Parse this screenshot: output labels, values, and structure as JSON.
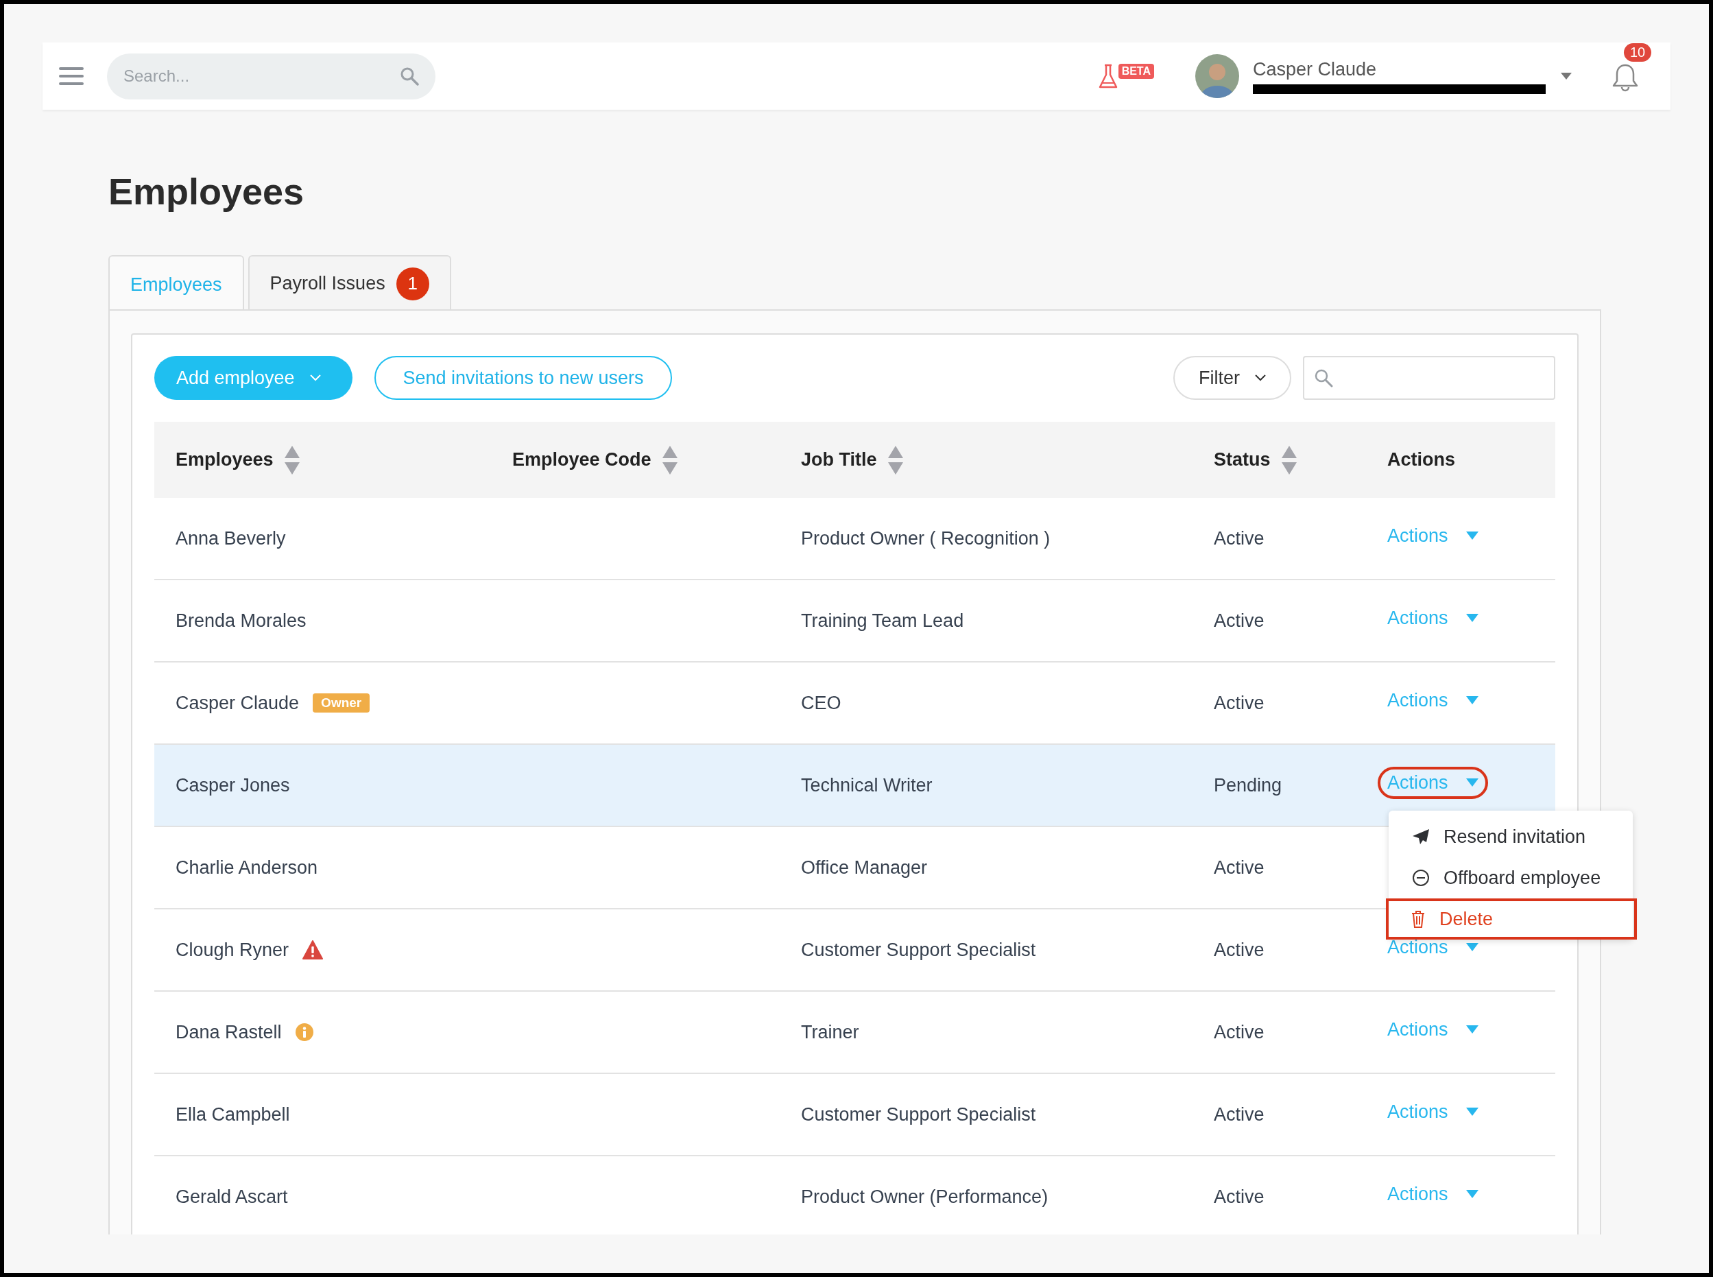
{
  "header": {
    "search": {
      "placeholder": "Search..."
    },
    "beta_label": "BETA",
    "user": {
      "name": "Casper Claude"
    },
    "notifications": {
      "count": "10"
    }
  },
  "page_title": "Employees",
  "tabs": [
    {
      "label": "Employees",
      "selected": true
    },
    {
      "label": "Payroll Issues",
      "selected": false,
      "badge": "1"
    }
  ],
  "toolbar": {
    "add_button": "Add employee",
    "invite_button": "Send invitations to new users",
    "filter_button": "Filter"
  },
  "table": {
    "columns": [
      {
        "label": "Employees",
        "sortable": true
      },
      {
        "label": "Employee Code",
        "sortable": true
      },
      {
        "label": "Job Title",
        "sortable": true
      },
      {
        "label": "Status",
        "sortable": true
      },
      {
        "label": "Actions",
        "sortable": false
      }
    ],
    "rows": [
      {
        "name": "Anna Beverly",
        "job_title": "Product Owner ( Recognition )",
        "status": "Active",
        "actions": {
          "label": "Actions",
          "highlighted": false
        },
        "selected": false
      },
      {
        "name": "Brenda Morales",
        "job_title": "Training Team Lead",
        "status": "Active",
        "actions": {
          "label": "Actions",
          "highlighted": false
        },
        "selected": false
      },
      {
        "name": "Casper Claude",
        "marker": {
          "kind": "badge",
          "label": "Owner"
        },
        "job_title": "CEO",
        "status": "Active",
        "actions": {
          "label": "Actions",
          "highlighted": false
        },
        "selected": false
      },
      {
        "name": "Casper Jones",
        "job_title": "Technical Writer",
        "status": "Pending",
        "actions": {
          "label": "Actions",
          "highlighted": true
        },
        "selected": true,
        "menu": {
          "items": [
            {
              "kind": "send",
              "label": "Resend invitation",
              "highlighted": false
            },
            {
              "kind": "offboard",
              "label": "Offboard employee",
              "highlighted": false
            },
            {
              "kind": "delete",
              "label": "Delete",
              "highlighted": true
            }
          ]
        }
      },
      {
        "name": "Charlie Anderson",
        "job_title": "Office Manager",
        "status": "Active",
        "selected": false
      },
      {
        "name": "Clough Ryner",
        "marker": {
          "kind": "warning"
        },
        "job_title": "Customer Support Specialist",
        "status": "Active",
        "actions": {
          "label": "Actions",
          "highlighted": false
        },
        "selected": false
      },
      {
        "name": "Dana Rastell",
        "marker": {
          "kind": "info"
        },
        "job_title": "Trainer",
        "status": "Active",
        "actions": {
          "label": "Actions",
          "highlighted": false
        },
        "selected": false
      },
      {
        "name": "Ella Campbell",
        "job_title": "Customer Support Specialist",
        "status": "Active",
        "actions": {
          "label": "Actions",
          "highlighted": false
        },
        "selected": false
      },
      {
        "name": "Gerald Ascart",
        "job_title": "Product Owner (Performance)",
        "status": "Active",
        "actions": {
          "label": "Actions",
          "highlighted": false
        },
        "selected": false
      }
    ]
  }
}
